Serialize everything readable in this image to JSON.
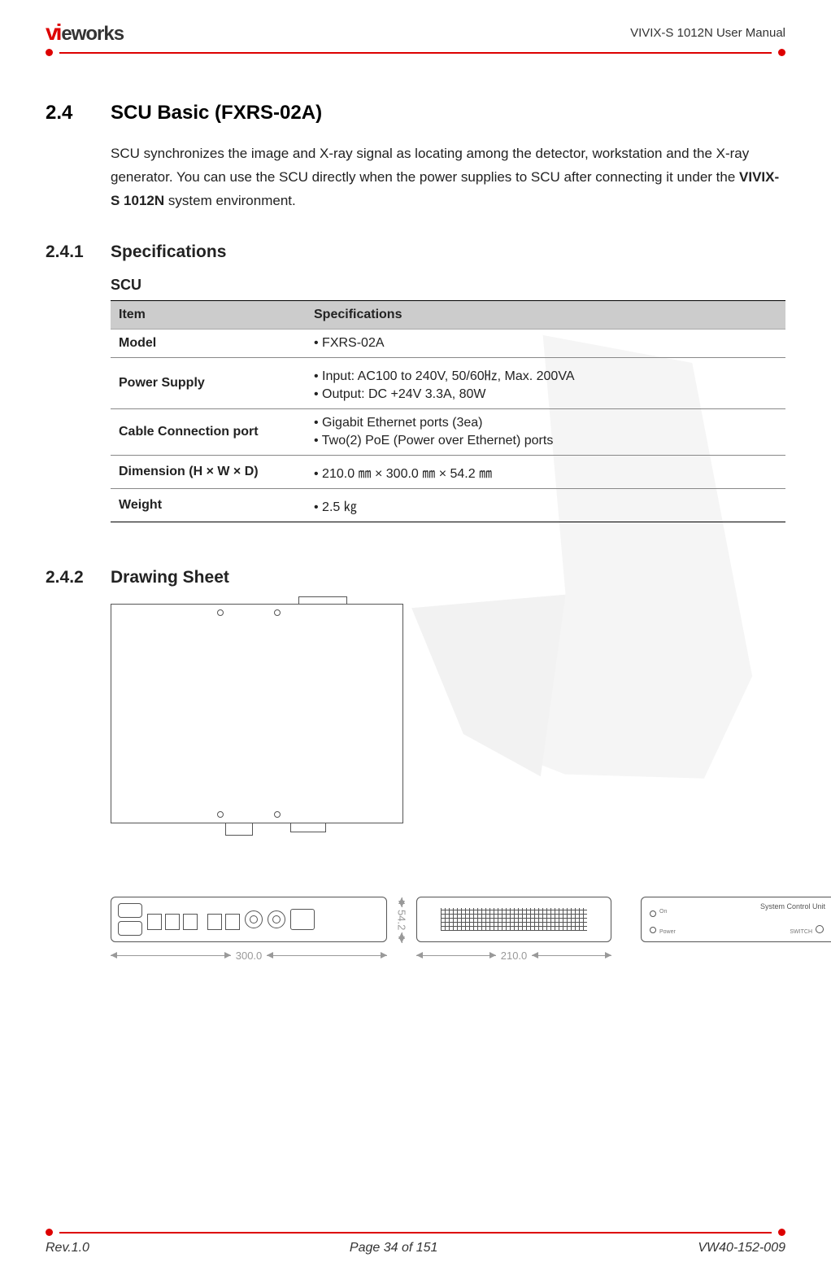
{
  "header": {
    "logo_text": "vieworks",
    "doc_title": "VIVIX-S 1012N User Manual"
  },
  "section": {
    "num": "2.4",
    "title": "SCU Basic (FXRS-02A)",
    "para_pre": "SCU synchronizes the image and X-ray signal as locating among the detector, workstation and the X-ray generator. You can use the SCU directly when the power supplies to SCU after connecting it under the ",
    "para_bold": "VIVIX-S 1012N",
    "para_post": " system environment."
  },
  "sub1": {
    "num": "2.4.1",
    "title": "Specifications",
    "table_label": "SCU",
    "th_item": "Item",
    "th_spec": "Specifications",
    "rows": {
      "model": {
        "item": "Model",
        "v1": "FXRS-02A"
      },
      "power": {
        "item": "Power Supply",
        "v1": "Input: AC100 to 240V, 50/60㎐, Max. 200VA",
        "v2": "Output: DC +24V 3.3A, 80W"
      },
      "cable": {
        "item": "Cable Connection port",
        "v1": "Gigabit Ethernet ports (3ea)",
        "v2": "Two(2) PoE (Power over Ethernet) ports"
      },
      "dim": {
        "item": "Dimension (H × W × D)",
        "v1": "210.0 ㎜ × 300.0 ㎜ × 54.2 ㎜"
      },
      "weight": {
        "item": "Weight",
        "v1": "2.5 ㎏"
      }
    }
  },
  "sub2": {
    "num": "2.4.2",
    "title": "Drawing Sheet",
    "dim_w": "300.0",
    "dim_h": "54.2",
    "dim_d": "210.0",
    "back_label": "System Control Unit",
    "back_on": "On",
    "back_power": "Power",
    "back_switch": "SWITCH"
  },
  "footer": {
    "rev": "Rev.1.0",
    "page": "Page 34 of 151",
    "doc_no": "VW40-152-009"
  }
}
